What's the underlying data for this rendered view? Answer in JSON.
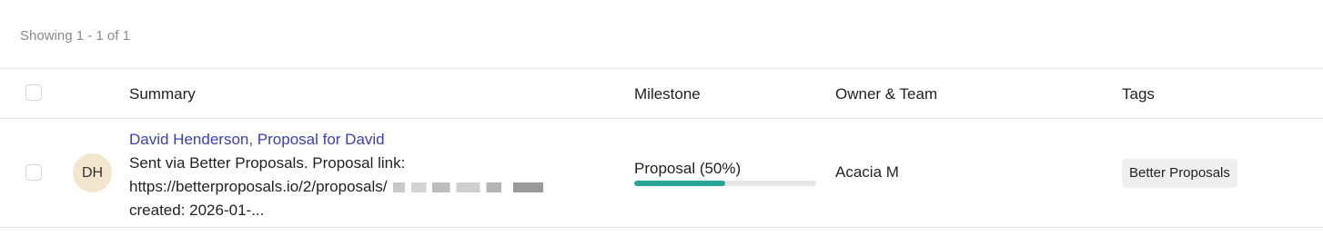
{
  "pagination": {
    "showing_text": "Showing 1 - 1 of 1"
  },
  "columns": {
    "summary": "Summary",
    "milestone": "Milestone",
    "owner_team": "Owner & Team",
    "tags": "Tags"
  },
  "rows": [
    {
      "avatar_initials": "DH",
      "title": "David Henderson, Proposal for David",
      "body_line1": "Sent via Better Proposals. Proposal link:",
      "body_line2": "https://betterproposals.io/2/proposals/",
      "body_line3": "created: 2026-01-...",
      "milestone_label": "Proposal (50%)",
      "milestone_progress": 0.5,
      "owner": "Acacia M",
      "tag": "Better Proposals"
    }
  ],
  "colors": {
    "link": "#3b3fb5",
    "progress_fill": "#27a596",
    "avatar_bg": "#f3e6cf"
  }
}
